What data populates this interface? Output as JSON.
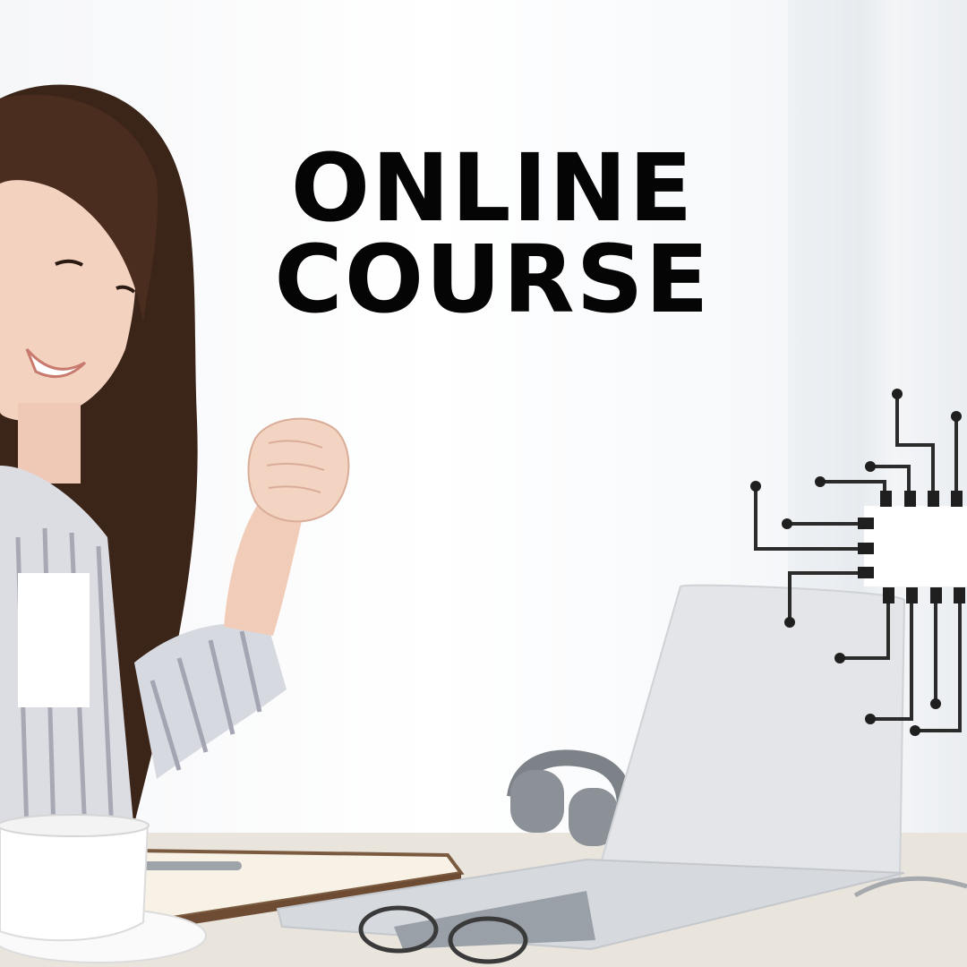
{
  "headline": {
    "line1": "ONLINE",
    "line2": "COURSE"
  },
  "colors": {
    "text": "#050505",
    "circuit": "#2b2b2b",
    "background": "#f6f7f9"
  },
  "graphics": {
    "person": "smiling-woman-with-raised-fist",
    "circuit": "microchip-circuit-icon"
  }
}
